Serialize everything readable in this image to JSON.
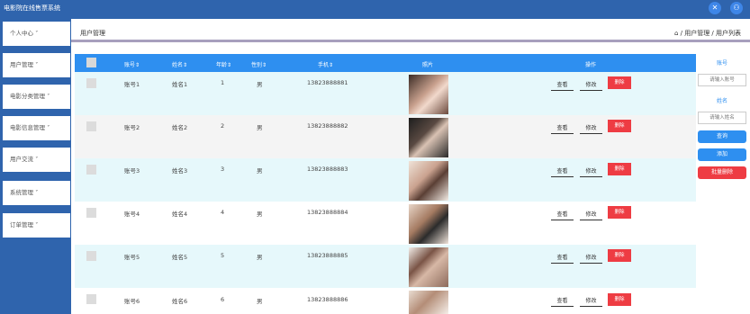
{
  "app": {
    "title": "电影院在线售票系统",
    "close_icon": "✕",
    "user_icon": "⚇"
  },
  "sidebar": {
    "items": [
      {
        "label": "个人中心 ˅"
      },
      {
        "label": "用户管理 ˅"
      },
      {
        "label": "电影分类管理 ˅"
      },
      {
        "label": "电影信息管理 ˅"
      },
      {
        "label": "用户交流 ˅"
      },
      {
        "label": "系统管理 ˅"
      },
      {
        "label": "订单管理 ˅"
      }
    ]
  },
  "breadcrumb": {
    "title": "用户管理",
    "path": "⌂ / 用户管理 / 用户列表"
  },
  "table": {
    "headers": {
      "account": "账号⇕",
      "name": "姓名⇕",
      "age": "年龄⇕",
      "gender": "性别⇕",
      "phone": "手机⇕",
      "photo": "照片",
      "actions": "操作"
    },
    "rows": [
      {
        "account": "账号1",
        "name": "姓名1",
        "age": "1",
        "gender": "男",
        "phone": "13823888881"
      },
      {
        "account": "账号2",
        "name": "姓名2",
        "age": "2",
        "gender": "男",
        "phone": "13823888882"
      },
      {
        "account": "账号3",
        "name": "姓名3",
        "age": "3",
        "gender": "男",
        "phone": "13823888883"
      },
      {
        "account": "账号4",
        "name": "姓名4",
        "age": "4",
        "gender": "男",
        "phone": "13823888884"
      },
      {
        "account": "账号5",
        "name": "姓名5",
        "age": "5",
        "gender": "男",
        "phone": "13823888885"
      },
      {
        "account": "账号6",
        "name": "姓名6",
        "age": "6",
        "gender": "男",
        "phone": "13823888886"
      }
    ],
    "view_label": "查看",
    "edit_label": "修改",
    "delete_label": "删除"
  },
  "filter": {
    "account_label": "账号",
    "account_placeholder": "请输入账号",
    "name_label": "姓名",
    "name_placeholder": "请输入姓名",
    "search_label": "查询",
    "add_label": "添加",
    "batch_delete_label": "批量删除"
  },
  "colors": {
    "sidebar": "#2f64ad",
    "table_header": "#2e8ff0",
    "delete": "#ee3c43",
    "row_alt": "#e6f8fb"
  }
}
